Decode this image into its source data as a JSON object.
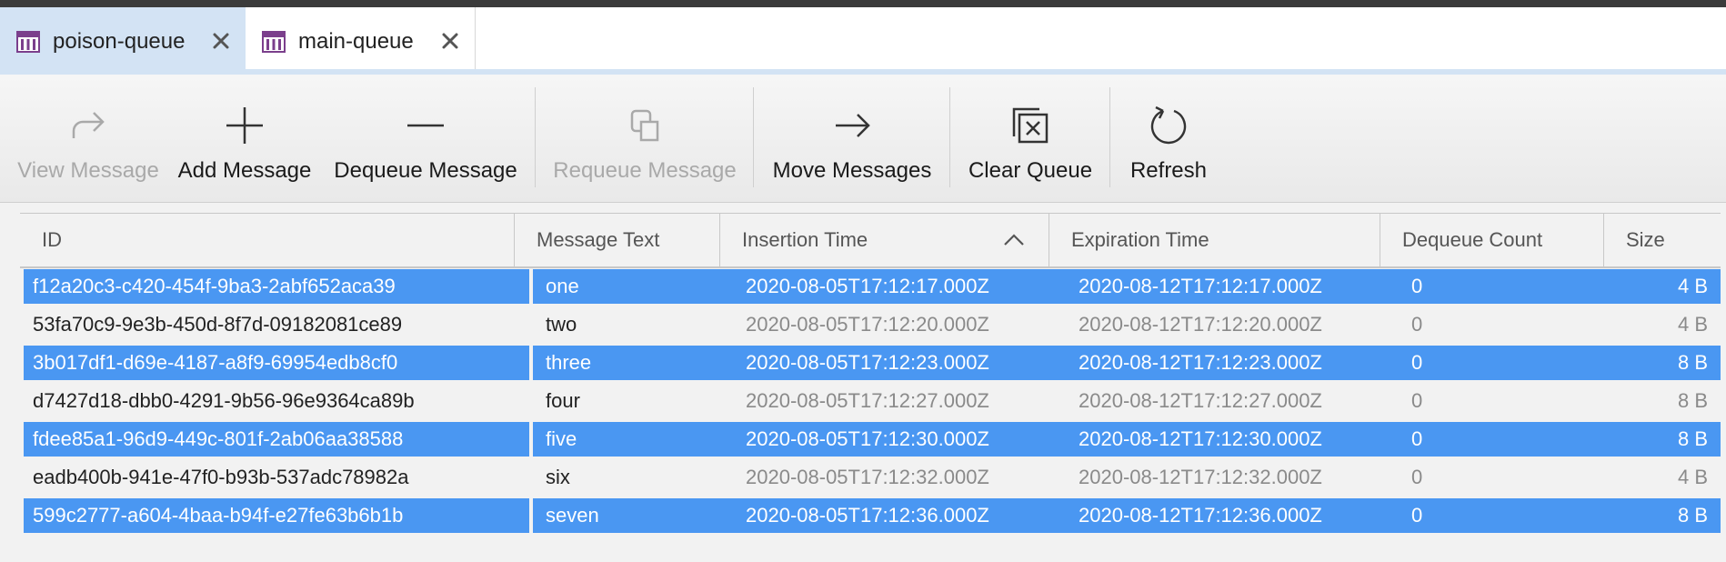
{
  "tabs": [
    {
      "label": "poison-queue",
      "active": true
    },
    {
      "label": "main-queue",
      "active": false
    }
  ],
  "toolbar": {
    "view_message": "View Message",
    "add_message": "Add Message",
    "dequeue_message": "Dequeue Message",
    "requeue_message": "Requeue Message",
    "move_messages": "Move Messages",
    "clear_queue": "Clear Queue",
    "refresh": "Refresh"
  },
  "columns": {
    "id": "ID",
    "message_text": "Message Text",
    "insertion_time": "Insertion Time",
    "expiration_time": "Expiration Time",
    "dequeue_count": "Dequeue Count",
    "size": "Size"
  },
  "sort": {
    "column": "insertion_time",
    "direction": "ascending"
  },
  "colors": {
    "selection": "#4a97f2",
    "active_tab": "#d3e3f4",
    "queue_icon": "#7b3f8c"
  },
  "rows": [
    {
      "id": "f12a20c3-c420-454f-9ba3-2abf652aca39",
      "text": "one",
      "inserted": "2020-08-05T17:12:17.000Z",
      "expires": "2020-08-12T17:12:17.000Z",
      "dequeue": "0",
      "size": "4 B",
      "selected": true
    },
    {
      "id": "53fa70c9-9e3b-450d-8f7d-09182081ce89",
      "text": "two",
      "inserted": "2020-08-05T17:12:20.000Z",
      "expires": "2020-08-12T17:12:20.000Z",
      "dequeue": "0",
      "size": "4 B",
      "selected": false
    },
    {
      "id": "3b017df1-d69e-4187-a8f9-69954edb8cf0",
      "text": "three",
      "inserted": "2020-08-05T17:12:23.000Z",
      "expires": "2020-08-12T17:12:23.000Z",
      "dequeue": "0",
      "size": "8 B",
      "selected": true
    },
    {
      "id": "d7427d18-dbb0-4291-9b56-96e9364ca89b",
      "text": "four",
      "inserted": "2020-08-05T17:12:27.000Z",
      "expires": "2020-08-12T17:12:27.000Z",
      "dequeue": "0",
      "size": "8 B",
      "selected": false
    },
    {
      "id": "fdee85a1-96d9-449c-801f-2ab06aa38588",
      "text": "five",
      "inserted": "2020-08-05T17:12:30.000Z",
      "expires": "2020-08-12T17:12:30.000Z",
      "dequeue": "0",
      "size": "8 B",
      "selected": true
    },
    {
      "id": "eadb400b-941e-47f0-b93b-537adc78982a",
      "text": "six",
      "inserted": "2020-08-05T17:12:32.000Z",
      "expires": "2020-08-12T17:12:32.000Z",
      "dequeue": "0",
      "size": "4 B",
      "selected": false
    },
    {
      "id": "599c2777-a604-4baa-b94f-e27fe63b6b1b",
      "text": "seven",
      "inserted": "2020-08-05T17:12:36.000Z",
      "expires": "2020-08-12T17:12:36.000Z",
      "dequeue": "0",
      "size": "8 B",
      "selected": true
    }
  ]
}
